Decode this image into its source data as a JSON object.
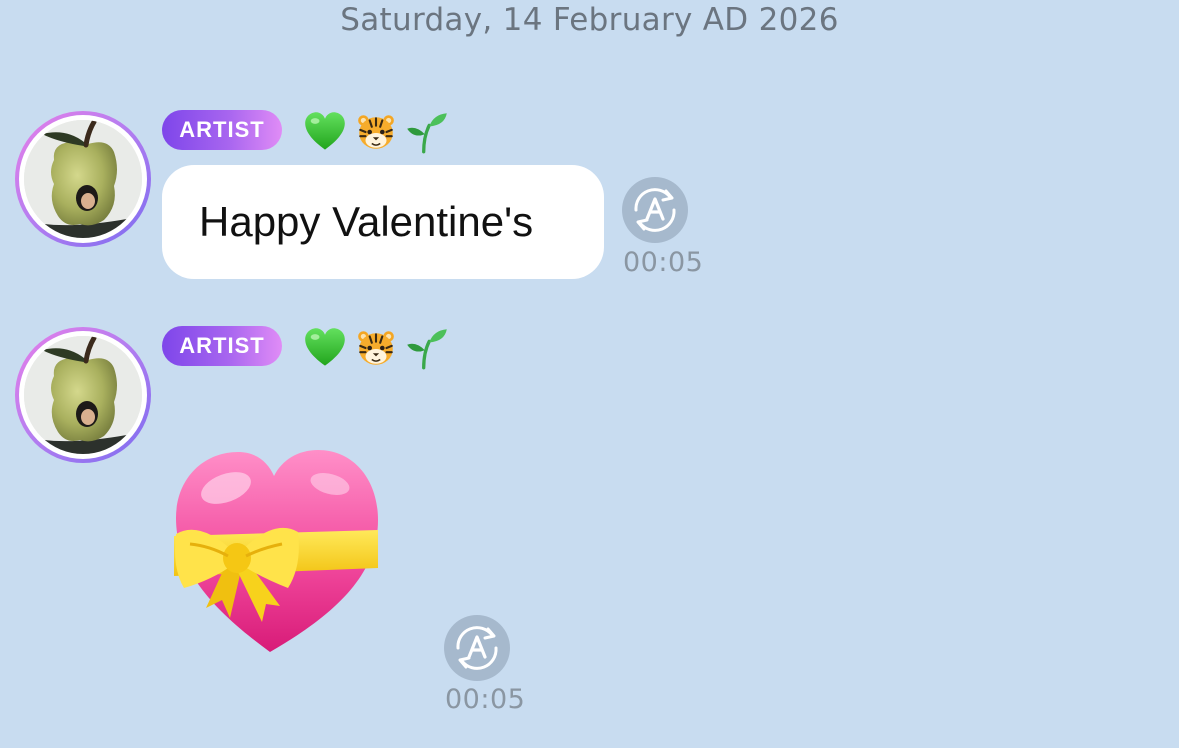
{
  "date_header": "Saturday, 14 February AD 2026",
  "messages": [
    {
      "sender_badge": "ARTIST",
      "emoji_icons": [
        "green-heart-icon",
        "tiger-face-icon",
        "seedling-icon"
      ],
      "text": "Happy Valentine's",
      "time": "00:05",
      "action_icon": "translate-icon"
    },
    {
      "sender_badge": "ARTIST",
      "emoji_icons": [
        "green-heart-icon",
        "tiger-face-icon",
        "seedling-icon"
      ],
      "sticker_icon": "heart-with-ribbon-icon",
      "time": "00:05",
      "action_icon": "translate-icon"
    }
  ],
  "colors": {
    "background": "#c8dcf0",
    "bubble": "#ffffff",
    "badge_gradient_start": "#7e46ea",
    "badge_gradient_end": "#e08cf6",
    "timestamp": "#8a96a2",
    "translate_button": "#a6b9cd"
  }
}
